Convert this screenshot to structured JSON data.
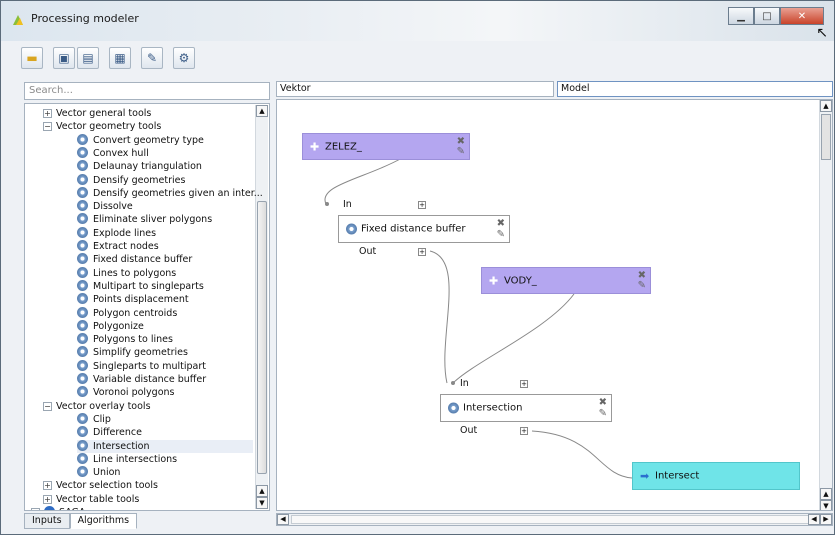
{
  "window": {
    "title": "Processing modeler"
  },
  "toolbar": {
    "icons": [
      "open-icon",
      "save-icon",
      "save-as-icon",
      "export-image-icon",
      "edit-help-icon",
      "run-icon"
    ]
  },
  "left_panel": {
    "search_placeholder": "Search...",
    "tree": [
      {
        "level": 1,
        "expander": "+",
        "label": "Vector general tools"
      },
      {
        "level": 1,
        "expander": "−",
        "label": "Vector geometry tools"
      },
      {
        "level": 2,
        "label": "Convert geometry type"
      },
      {
        "level": 2,
        "label": "Convex hull"
      },
      {
        "level": 2,
        "label": "Delaunay triangulation"
      },
      {
        "level": 2,
        "label": "Densify geometries"
      },
      {
        "level": 2,
        "label": "Densify geometries given an inter..."
      },
      {
        "level": 2,
        "label": "Dissolve"
      },
      {
        "level": 2,
        "label": "Eliminate sliver polygons"
      },
      {
        "level": 2,
        "label": "Explode lines"
      },
      {
        "level": 2,
        "label": "Extract nodes"
      },
      {
        "level": 2,
        "label": "Fixed distance buffer"
      },
      {
        "level": 2,
        "label": "Lines to polygons"
      },
      {
        "level": 2,
        "label": "Multipart to singleparts"
      },
      {
        "level": 2,
        "label": "Points displacement"
      },
      {
        "level": 2,
        "label": "Polygon centroids"
      },
      {
        "level": 2,
        "label": "Polygonize"
      },
      {
        "level": 2,
        "label": "Polygons to lines"
      },
      {
        "level": 2,
        "label": "Simplify geometries"
      },
      {
        "level": 2,
        "label": "Singleparts to multipart"
      },
      {
        "level": 2,
        "label": "Variable distance buffer"
      },
      {
        "level": 2,
        "label": "Voronoi polygons"
      },
      {
        "level": 1,
        "expander": "−",
        "label": "Vector overlay tools"
      },
      {
        "level": 2,
        "label": "Clip"
      },
      {
        "level": 2,
        "label": "Difference"
      },
      {
        "level": 2,
        "label": "Intersection",
        "selected": true
      },
      {
        "level": 2,
        "label": "Line intersections"
      },
      {
        "level": 2,
        "label": "Union"
      },
      {
        "level": 1,
        "expander": "+",
        "label": "Vector selection tools"
      },
      {
        "level": 1,
        "expander": "+",
        "label": "Vector table tools"
      },
      {
        "level": 0,
        "expander": "+",
        "label": "SAGA",
        "icon": "saga-icon"
      }
    ],
    "tabs": [
      "Inputs",
      "Algorithms"
    ],
    "active_tab": "Algorithms"
  },
  "model": {
    "name": "Vektor",
    "group": "Model"
  },
  "canvas": {
    "inputs": [
      {
        "id": "zelez",
        "label": "ZELEZ_"
      },
      {
        "id": "vody",
        "label": "VODY_"
      }
    ],
    "algorithms": [
      {
        "id": "buffer",
        "label": "Fixed distance buffer",
        "in_label": "In",
        "out_label": "Out"
      },
      {
        "id": "intersect",
        "label": "Intersection",
        "in_label": "In",
        "out_label": "Out"
      }
    ],
    "outputs": [
      {
        "id": "out",
        "label": "Intersect"
      }
    ]
  },
  "colors": {
    "input_node": "#b4a6f0",
    "output_node": "#6fe4e8",
    "algorithm_node": "#ffffff"
  }
}
